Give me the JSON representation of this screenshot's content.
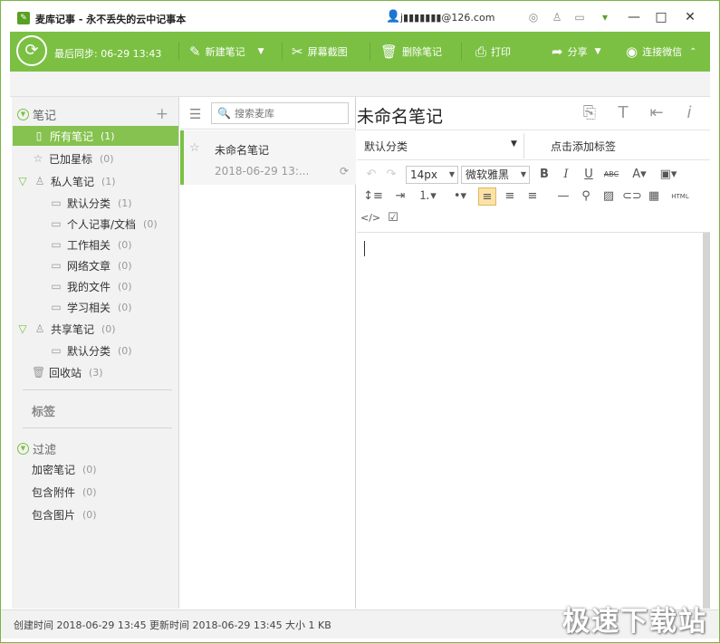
{
  "titlebar": {
    "title": "麦库记事 - 永不丢失的云中记事本",
    "user": "j▮▮▮▮▮▮▮@126.com",
    "icons": [
      "skin-icon",
      "shirt-icon",
      "message-icon",
      "pending-icon",
      "minimize-icon",
      "maximize-icon",
      "close-icon"
    ]
  },
  "toolbar": {
    "sync_status": "最后同步: 06-29 13:43",
    "new_note": "新建笔记",
    "screenshot": "屏幕截图",
    "delete_note": "删除笔记",
    "print": "打印",
    "share": "分享",
    "wechat": "连接微信"
  },
  "sidebar": {
    "notes_header": "笔记",
    "items": [
      {
        "label": "所有笔记",
        "count": "(1)"
      },
      {
        "label": "已加星标",
        "count": "(0)"
      },
      {
        "label": "私人笔记",
        "count": "(1)"
      },
      {
        "label": "默认分类",
        "count": "(1)"
      },
      {
        "label": "个人记事/文档",
        "count": "(0)"
      },
      {
        "label": "工作相关",
        "count": "(0)"
      },
      {
        "label": "网络文章",
        "count": "(0)"
      },
      {
        "label": "我的文件",
        "count": "(0)"
      },
      {
        "label": "学习相关",
        "count": "(0)"
      },
      {
        "label": "共享笔记",
        "count": "(0)"
      },
      {
        "label": "默认分类",
        "count": "(0)"
      },
      {
        "label": "回收站",
        "count": "(3)"
      }
    ],
    "tags_header": "标签",
    "filter_header": "过滤",
    "filters": [
      {
        "label": "加密笔记",
        "count": "(0)"
      },
      {
        "label": "包含附件",
        "count": "(0)"
      },
      {
        "label": "包含图片",
        "count": "(0)"
      }
    ]
  },
  "notelist": {
    "search_placeholder": "搜索麦库",
    "notes": [
      {
        "title": "未命名笔记",
        "date": "2018-06-29 13:..."
      }
    ]
  },
  "editor": {
    "title": "未命名笔记",
    "category": "默认分类",
    "add_tag": "点击添加标签",
    "font_size": "14px",
    "font_family": "微软雅黑"
  },
  "statusbar": {
    "created": "创建时间 2018-06-29 13:45",
    "updated": "更新时间 2018-06-29 13:45",
    "size": "大小 1 KB"
  },
  "watermark": "极速下载站",
  "colors": {
    "accent": "#7bc043",
    "selected": "#86c24f",
    "highlight": "#fbe3a8"
  }
}
